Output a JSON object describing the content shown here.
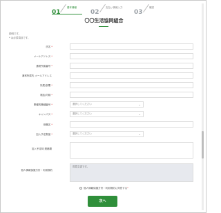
{
  "steps": [
    {
      "num": "01",
      "label": "基本情報"
    },
    {
      "num": "02",
      "label": "支払い情報入力"
    },
    {
      "num": "03",
      "label": "確認"
    }
  ],
  "title": "〇〇生活協同組合",
  "intro": {
    "line1": "説明です。",
    "line2": "* は必須項目です。"
  },
  "fields": {
    "name": {
      "label": "氏名",
      "required": "*"
    },
    "email": {
      "label": "メールアドレス",
      "required": "*"
    },
    "company_phone": {
      "label": "通常所属番号",
      "required": "*"
    },
    "company_email": {
      "label": "通常所属先 メールアドレス",
      "required": ""
    },
    "department": {
      "label": "所属/部署",
      "required": "*"
    },
    "phone": {
      "label": "電話/内線",
      "required": "*"
    },
    "business_type": {
      "label": "業種的職種番号",
      "required": "*",
      "value": "選択してください"
    },
    "campus": {
      "label": "キャンパス",
      "required": "*",
      "value": "選択してください"
    },
    "title_field": {
      "label": "役職名",
      "required": "*"
    },
    "join_count": {
      "label": "加入予定数量",
      "required": "*",
      "value": "選択してください"
    },
    "remarks": {
      "label": "加入予定時 連絡欄",
      "required": ""
    },
    "terms": {
      "label": "個人情報保護方針・利用規約",
      "required": "",
      "value": "同意文書です。"
    }
  },
  "consent": {
    "text": "個人情報保護方針・利用規約に同意する",
    "required": "*"
  },
  "next_label": "次へ",
  "colors": {
    "accent": "#2f8f3a",
    "required": "#e05050"
  }
}
